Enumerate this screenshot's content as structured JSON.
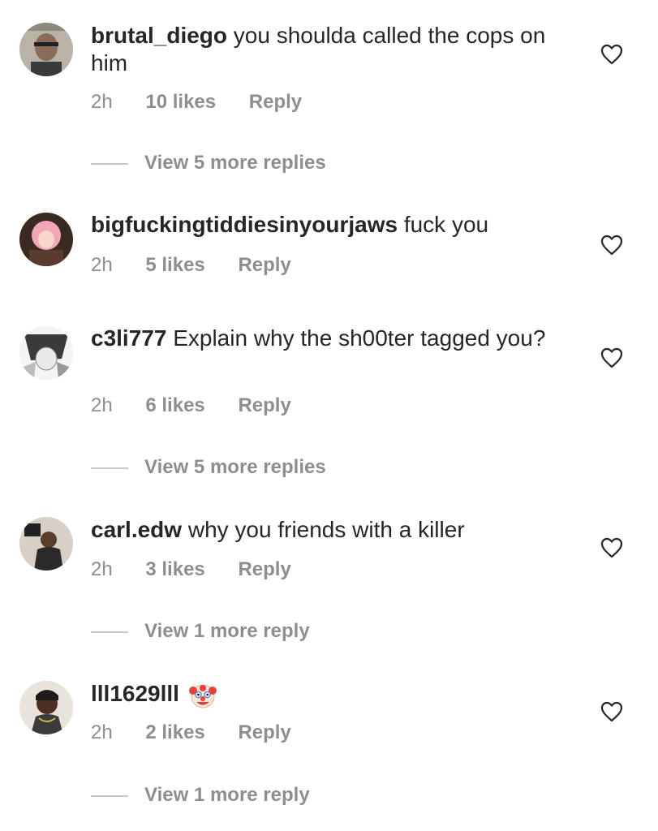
{
  "comments": [
    {
      "username": "brutal_diego",
      "text": "you shoulda called the cops on him",
      "time": "2h",
      "likes": "10 likes",
      "reply": "Reply",
      "view_replies": "View 5 more replies",
      "avatar_icon": "avatar-photo"
    },
    {
      "username": "bigfuckingtiddiesinyourjaws",
      "text": "fuck you",
      "time": "2h",
      "likes": "5 likes",
      "reply": "Reply",
      "avatar_icon": "avatar-anime"
    },
    {
      "username": "c3li777",
      "text": "Explain why the sh00ter tagged you?",
      "time": "2h",
      "likes": "6 likes",
      "reply": "Reply",
      "view_replies": "View 5 more replies",
      "avatar_icon": "avatar-manga"
    },
    {
      "username": "carl.edw",
      "text": "why you friends with a killer",
      "time": "2h",
      "likes": "3 likes",
      "reply": "Reply",
      "view_replies": "View 1 more reply",
      "avatar_icon": "avatar-photo"
    },
    {
      "username": "lll1629lll",
      "text": "",
      "emoji": "clown-face",
      "time": "2h",
      "likes": "2 likes",
      "reply": "Reply",
      "view_replies": "View 1 more reply",
      "avatar_icon": "avatar-photo"
    }
  ],
  "colors": {
    "text": "#262626",
    "secondary": "#8e8e8e",
    "divider": "#c7c7c7"
  }
}
